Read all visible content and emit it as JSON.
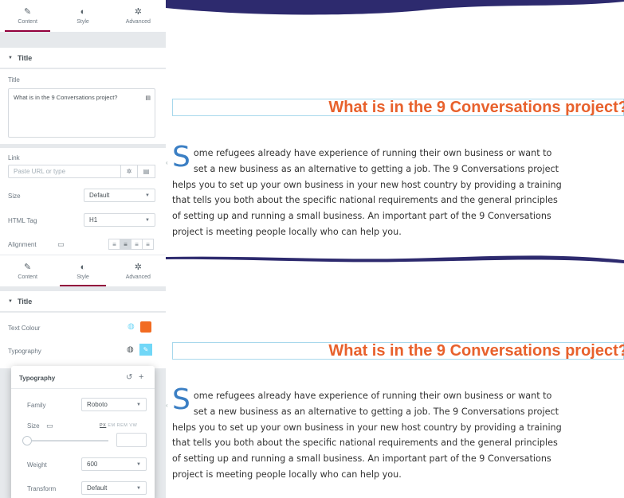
{
  "editor": {
    "tabs_top": [
      {
        "label": "Content",
        "icon": "pencil-icon",
        "active": true
      },
      {
        "label": "Style",
        "icon": "half-circle-icon",
        "active": false
      },
      {
        "label": "Advanced",
        "icon": "gear-icon",
        "active": false
      }
    ],
    "tabs_second": [
      {
        "label": "Content",
        "icon": "pencil-icon",
        "active": false
      },
      {
        "label": "Style",
        "icon": "half-circle-icon",
        "active": true
      },
      {
        "label": "Advanced",
        "icon": "gear-icon",
        "active": false
      }
    ],
    "content_section": {
      "header": "Title",
      "title_label": "Title",
      "title_value": "What is in the 9 Conversations project?",
      "link_label": "Link",
      "link_placeholder": "Paste URL or type",
      "size_label": "Size",
      "size_value": "Default",
      "html_tag_label": "HTML Tag",
      "html_tag_value": "H1",
      "alignment_label": "Alignment",
      "alignment_selected": "center"
    },
    "style_section": {
      "header": "Title",
      "text_colour_label": "Text Colour",
      "text_colour": "#f26b21",
      "typography_label": "Typography"
    },
    "typography_popover": {
      "title": "Typography",
      "family_label": "Family",
      "family_value": "Roboto",
      "size_label": "Size",
      "units": [
        "PX",
        "EM",
        "REM",
        "VW"
      ],
      "unit_selected": "PX",
      "weight_label": "Weight",
      "weight_value": "600",
      "transform_label": "Transform",
      "transform_value": "Default"
    }
  },
  "preview": {
    "heading": "What is in the 9 Conversations project?",
    "heading_color": "#e8612c",
    "wave_color": "#2d2a6e",
    "dropcap": "S",
    "para_first": "ome refugees already have experience of running their own business or want to set a new business as an alternative to getting a job. The 9 Conversations project helps you to set up your own business in your new host country by providing a training that tells you both about the specific national requirements and the general principles of setting up and running a small business. An important part of the 9 Conversations project is meeting people locally who can help you."
  }
}
